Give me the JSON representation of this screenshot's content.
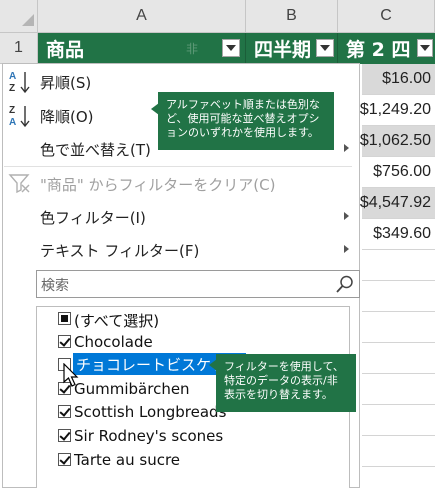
{
  "sheet": {
    "columns": [
      "A",
      "B",
      "C"
    ],
    "row_number": "1",
    "headers": [
      "商品",
      "四半期",
      "第 2 四"
    ],
    "header_hidden_prefix": "非",
    "col_c_values": [
      "$16.00",
      "$1,249.20",
      "$1,062.50",
      "$756.00",
      "$4,547.92",
      "$349.60"
    ]
  },
  "menu": {
    "sort_asc": "昇順(S)",
    "sort_desc": "降順(O)",
    "sort_by_color": "色で並べ替え(T)",
    "clear_filter": "\"商品\" からフィルターをクリア(C)",
    "color_filter": "色フィルター(I)",
    "text_filter": "テキスト フィルター(F)",
    "search_placeholder": "検索"
  },
  "filter_list": {
    "select_all": "(すべて選択)",
    "items": [
      {
        "label": "Chocolade",
        "checked": true
      },
      {
        "label": "チョコレートビスケット",
        "checked": false
      },
      {
        "label": "Gummibärchen",
        "checked": true
      },
      {
        "label": "Scottish Longbreads",
        "checked": true
      },
      {
        "label": "Sir Rodney's scones",
        "checked": true
      },
      {
        "label": "Tarte au sucre",
        "checked": true
      }
    ]
  },
  "callouts": {
    "sort": "アルファベット順または色別など、使用可能な並べ替えオプションのいずれかを使用します。",
    "filter": "フィルターを使用して、特定のデータの表示/非表示を切り替えます。"
  },
  "colors": {
    "header_green": "#217346",
    "callout_green": "#217346",
    "sort_icon_blue": "#2e75b6",
    "selection_blue": "#0078d7"
  }
}
